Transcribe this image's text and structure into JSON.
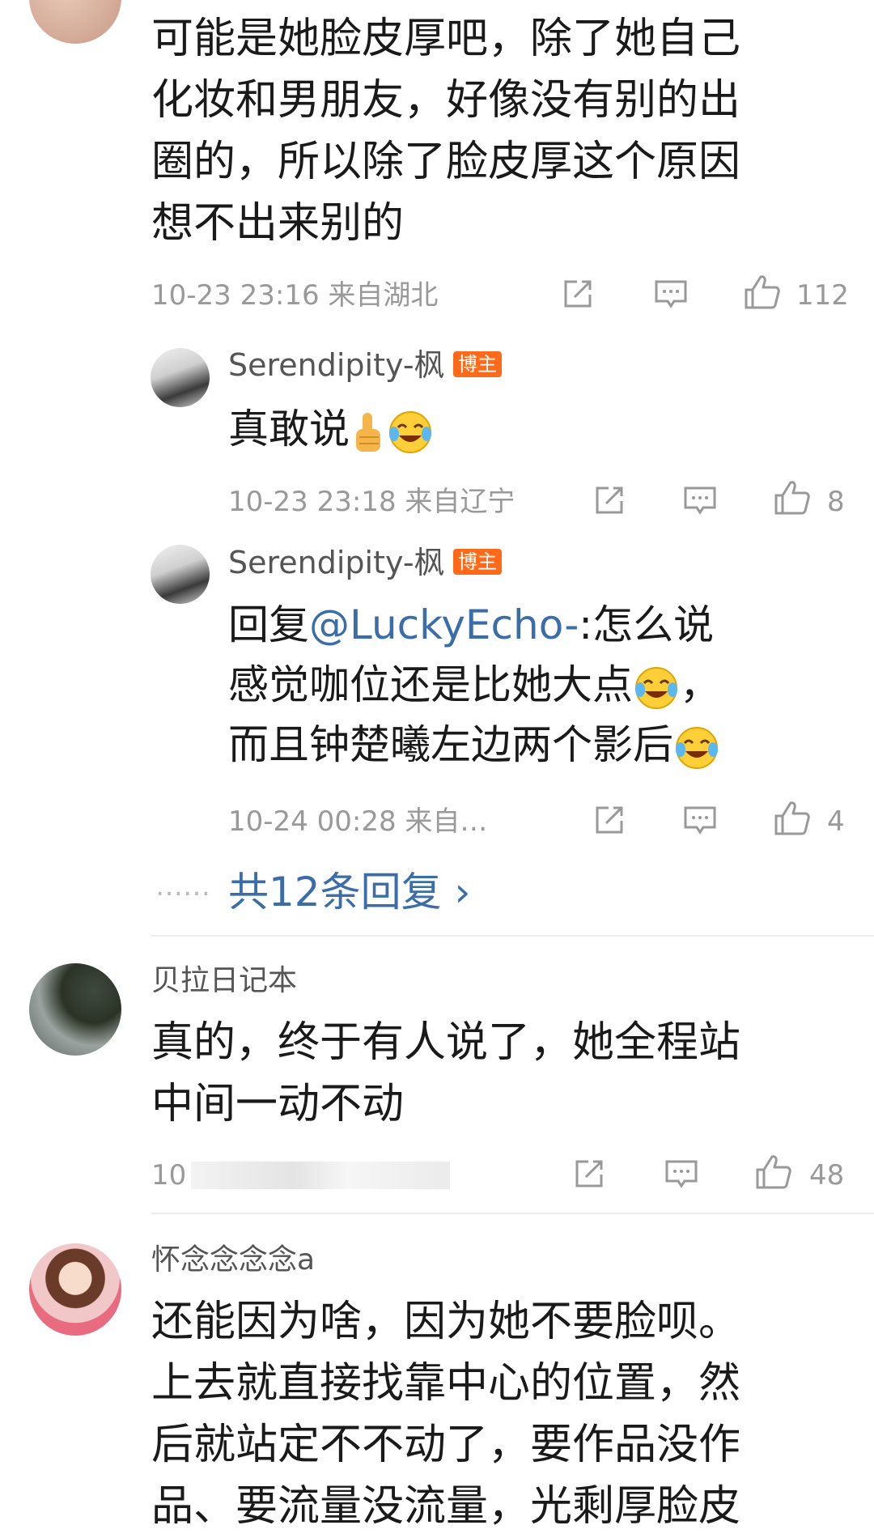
{
  "comments": [
    {
      "text_lines": [
        "可能是她脸皮厚吧，除了她自己",
        "化妆和男朋友，好像没有别的出",
        "圈的，所以除了脸皮厚这个原因",
        "想不出来别的"
      ],
      "meta": "10-23 23:16  来自湖北",
      "likes": "112",
      "replies": [
        {
          "username": "Serendipity-枫",
          "badge": "博主",
          "text": "真敢说",
          "meta": "10-23 23:18  来自辽宁",
          "likes": "8"
        },
        {
          "username": "Serendipity-枫",
          "badge": "博主",
          "reply_prefix": "回复",
          "mention": "@LuckyEcho-",
          "line1_rest": ":怎么说",
          "line2": "感觉咖位还是比她大点",
          "line2_tail": "，",
          "line3": "而且钟楚曦左边两个影后",
          "meta": "10-24 00:28  来自…",
          "likes": "4"
        }
      ],
      "more_replies": "共12条回复 ›",
      "more_dots": "……"
    },
    {
      "username": "贝拉日记本",
      "text_lines": [
        "真的，终于有人说了，她全程站",
        "中间一动不动"
      ],
      "meta": "10",
      "likes": "48"
    },
    {
      "username": "怀念念念念a",
      "text_lines": [
        "还能因为啥，因为她不要脸呗。",
        "上去就直接找靠中心的位置，然",
        "后就站定不不动了，要作品没作",
        "品、要流量没流量，光剩厚脸皮"
      ]
    }
  ],
  "colors": {
    "link": "#3b6ea8",
    "badge": "#ff6a1a",
    "meta": "#999999"
  }
}
